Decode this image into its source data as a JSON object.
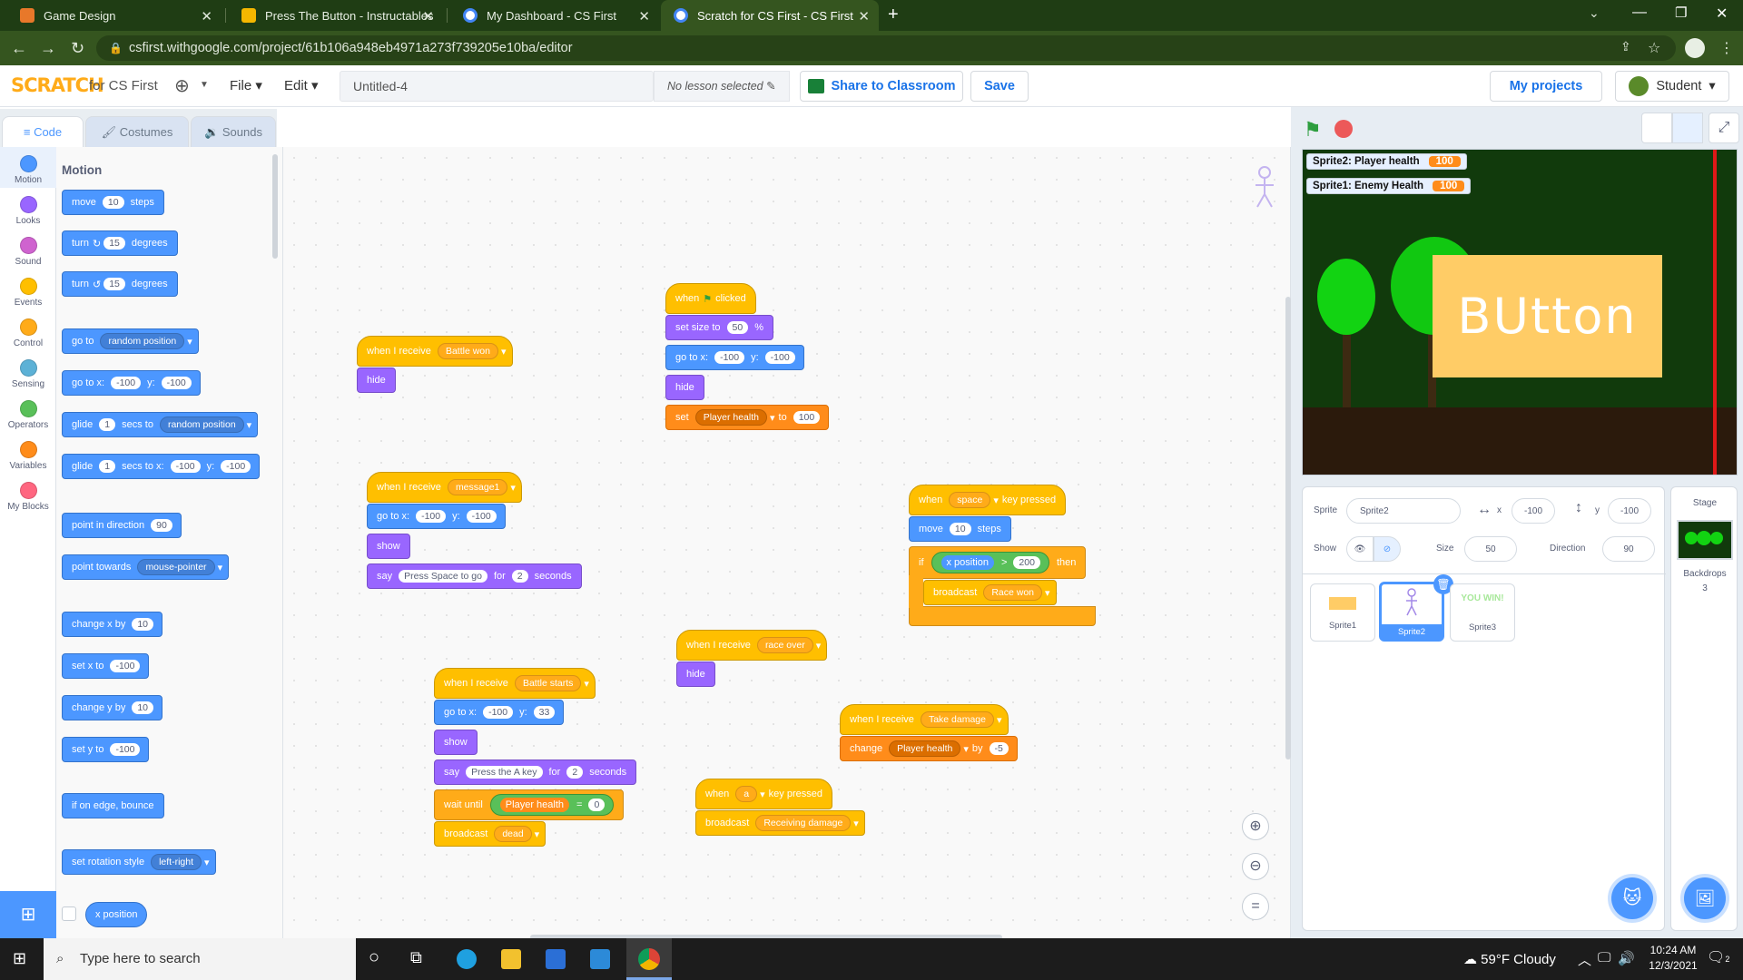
{
  "browser": {
    "tabs": [
      {
        "title": "Game Design"
      },
      {
        "title": "Press The Button - Instructables"
      },
      {
        "title": "My Dashboard - CS First"
      },
      {
        "title": "Scratch for CS First - CS First"
      }
    ],
    "url": "csfirst.withgoogle.com/project/61b106a948eb4971a273f739205e10ba/editor"
  },
  "menubar": {
    "logo": "SCRATCH",
    "subtitle": "for CS First",
    "file": "File",
    "edit": "Edit",
    "project_title": "Untitled-4",
    "lesson": "No lesson selected",
    "share": "Share to Classroom",
    "save": "Save",
    "my_projects": "My projects",
    "user": "Student"
  },
  "editor_tabs": {
    "code": "Code",
    "costumes": "Costumes",
    "sounds": "Sounds"
  },
  "categories": [
    {
      "label": "Motion",
      "color": "#4c97ff"
    },
    {
      "label": "Looks",
      "color": "#9966ff"
    },
    {
      "label": "Sound",
      "color": "#cf63cf"
    },
    {
      "label": "Events",
      "color": "#ffbf00"
    },
    {
      "label": "Control",
      "color": "#ffab19"
    },
    {
      "label": "Sensing",
      "color": "#5cb1d6"
    },
    {
      "label": "Operators",
      "color": "#59c059"
    },
    {
      "label": "Variables",
      "color": "#ff8c1a"
    },
    {
      "label": "My Blocks",
      "color": "#ff6680"
    }
  ],
  "palette": {
    "title": "Motion",
    "move": "move",
    "steps": "steps",
    "v10": "10",
    "turn": "turn",
    "degrees": "degrees",
    "v15": "15",
    "goto": "go to",
    "random_position": "random position",
    "gotoxy": "go to x:",
    "y": "y:",
    "vm100": "-100",
    "glide": "glide",
    "v1": "1",
    "secs_to": "secs to",
    "secs_to_x": "secs to x:",
    "point_in_direction": "point in direction",
    "v90": "90",
    "point_towards": "point towards",
    "mouse_pointer": "mouse-pointer",
    "change_x_by": "change x by",
    "set_x_to": "set x to",
    "change_y_by": "change y by",
    "set_y_to": "set y to",
    "if_on_edge": "if on edge, bounce",
    "set_rotation_style": "set rotation style",
    "left_right": "left-right",
    "x_position": "x position"
  },
  "scripts": {
    "s1": {
      "when_receive": "when I receive",
      "msg": "Battle won",
      "hide": "hide"
    },
    "s2": {
      "when": "when",
      "clicked": "clicked",
      "set_size": "set size to",
      "size": "50",
      "pct": "%",
      "goto": "go to x:",
      "x": "-100",
      "y_lbl": "y:",
      "y": "-100",
      "hide": "hide",
      "set": "set",
      "var": "Player health",
      "to": "to",
      "val": "100"
    },
    "s3": {
      "when_receive": "when I receive",
      "msg": "message1",
      "goto": "go to x:",
      "x": "-100",
      "y_lbl": "y:",
      "y": "-100",
      "show": "show",
      "say": "say",
      "text": "Press Space to go",
      "for": "for",
      "secs": "2",
      "seconds": "seconds"
    },
    "s4": {
      "when": "when",
      "key": "space",
      "key_pressed": "key pressed",
      "move": "move",
      "steps_val": "10",
      "steps": "steps",
      "if": "if",
      "x_position": "x position",
      "gt": ">",
      "cmp": "200",
      "then": "then",
      "broadcast": "broadcast",
      "msg": "Race won"
    },
    "s5": {
      "when_receive": "when I receive",
      "msg": "race over",
      "hide": "hide"
    },
    "s6": {
      "when_receive": "when I receive",
      "msg": "Battle starts",
      "goto": "go to x:",
      "x": "-100",
      "y_lbl": "y:",
      "y": "33",
      "show": "show",
      "say": "say",
      "text": "Press the A key",
      "for": "for",
      "secs": "2",
      "seconds": "seconds",
      "wait_until": "wait until",
      "var": "Player health",
      "eq": "=",
      "cmp": "0",
      "broadcast": "broadcast",
      "bmsg": "dead"
    },
    "s7": {
      "when_receive": "when I receive",
      "msg": "Take damage",
      "change": "change",
      "var": "Player health",
      "by": "by",
      "val": "-5"
    },
    "s8": {
      "when": "when",
      "key": "a",
      "key_pressed": "key pressed",
      "broadcast": "broadcast",
      "msg": "Receiving damage"
    }
  },
  "stage": {
    "monitors": [
      {
        "label": "Sprite2: Player health",
        "value": "100"
      },
      {
        "label": "Sprite1: Enemy Health",
        "value": "100"
      }
    ],
    "button_text": "BUtton"
  },
  "sprite_info": {
    "sprite_label": "Sprite",
    "name": "Sprite2",
    "x_label": "x",
    "x": "-100",
    "y_label": "y",
    "y": "-100",
    "show_label": "Show",
    "size_label": "Size",
    "size": "50",
    "direction_label": "Direction",
    "direction": "90",
    "sprites": [
      {
        "name": "Sprite1"
      },
      {
        "name": "Sprite2"
      },
      {
        "name": "Sprite3"
      }
    ],
    "sprite3_text": "YOU WIN!"
  },
  "stage_panel": {
    "title": "Stage",
    "backdrops_label": "Backdrops",
    "backdrops": "3"
  },
  "taskbar": {
    "search": "Type here to search",
    "weather": "59°F  Cloudy",
    "time": "10:24 AM",
    "date": "12/3/2021",
    "notifications": "2"
  }
}
